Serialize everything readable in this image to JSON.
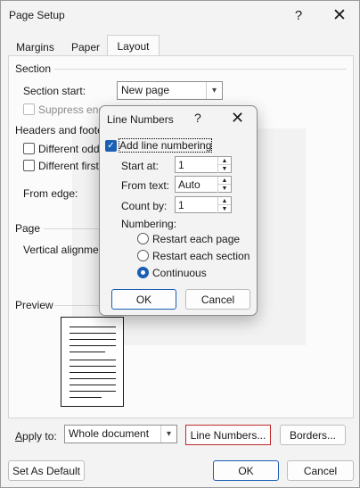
{
  "window": {
    "title": "Page Setup"
  },
  "tabs": [
    {
      "label": "Margins"
    },
    {
      "label": "Paper"
    },
    {
      "label": "Layout"
    }
  ],
  "section": {
    "heading": "Section",
    "start_label": "Section start:",
    "start_value": "New page",
    "suppress_label": "Suppress end"
  },
  "headers_footers": {
    "heading": "Headers and foote",
    "different_odd_label": "Different odd",
    "different_first_label": "Different first",
    "from_edge_label": "From edge:"
  },
  "page": {
    "heading": "Page",
    "vertical_alignment_label": "Vertical alignmen"
  },
  "preview": {
    "heading": "Preview"
  },
  "apply_to": {
    "label": "Apply to:",
    "value": "Whole document"
  },
  "buttons": {
    "line_numbers": "Line Numbers...",
    "borders": "Borders...",
    "set_default": "Set As Default",
    "ok": "OK",
    "cancel": "Cancel"
  },
  "line_numbers_dialog": {
    "title": "Line Numbers",
    "add_label": "Add line numbering",
    "add_checked": true,
    "start_at_label": "Start at:",
    "start_at_value": "1",
    "from_text_label": "From text:",
    "from_text_value": "Auto",
    "count_by_label": "Count by:",
    "count_by_value": "1",
    "numbering_label": "Numbering:",
    "options": [
      {
        "label": "Restart each page",
        "selected": false
      },
      {
        "label": "Restart each section",
        "selected": false
      },
      {
        "label": "Continuous",
        "selected": true
      }
    ],
    "ok": "OK",
    "cancel": "Cancel"
  },
  "icons": {
    "help": "?",
    "close": "✕",
    "dropdown": "chevron-down-icon",
    "check": "✓"
  },
  "colors": {
    "accent": "#1a5fb4",
    "highlight_border": "#c02a2a"
  }
}
